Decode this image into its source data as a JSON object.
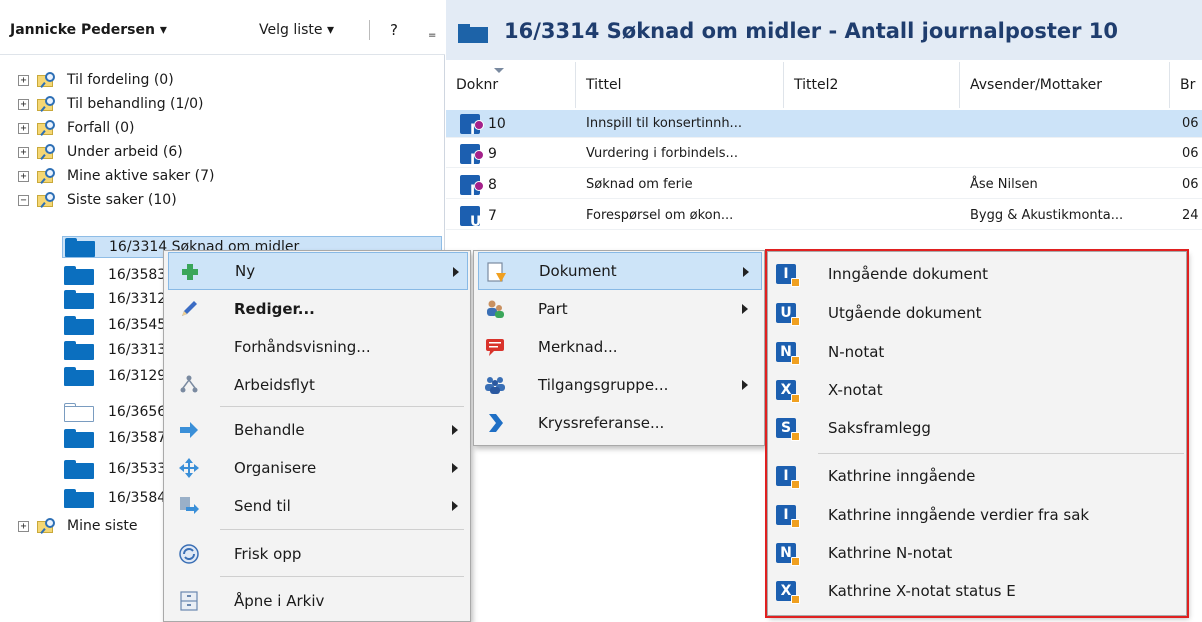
{
  "left_header": {
    "user": "Jannicke Pedersen",
    "user_arrow": "▾",
    "velg_liste": "Velg liste",
    "velg_arrow": "▾",
    "help": "?",
    "more": "="
  },
  "tree": [
    {
      "label": "Til fordeling (0)",
      "expander": "+"
    },
    {
      "label": "Til behandling (1/0)",
      "expander": "+"
    },
    {
      "label": "Forfall (0)",
      "expander": "+"
    },
    {
      "label": "Under arbeid (6)",
      "expander": "+"
    },
    {
      "label": "Mine aktive saker (7)",
      "expander": "+"
    },
    {
      "label": "Siste saker (10)",
      "expander": "−"
    }
  ],
  "cases": [
    {
      "label": "16/3314 Søknad om midler",
      "selected": true
    },
    {
      "label": "16/3583"
    },
    {
      "label": "16/3312"
    },
    {
      "label": "16/3545"
    },
    {
      "label": "16/3313"
    },
    {
      "label": "16/3129"
    },
    {
      "label": "16/3656",
      "empty": true
    },
    {
      "label": "16/3587"
    },
    {
      "label": "16/3533"
    },
    {
      "label": "16/3584"
    }
  ],
  "tree_last": {
    "label": "Mine siste",
    "expander": "+"
  },
  "right_header": {
    "title": "16/3314 Søknad om midler  - Antall journalposter 10"
  },
  "columns": [
    "Doknr",
    "Tittel",
    "Tittel2",
    "Avsender/Mottaker",
    "Br"
  ],
  "rows": [
    {
      "type": "I",
      "doknr": "10",
      "tittel": "Innspill til konsertinnh...",
      "avsender": "",
      "br": "06",
      "selected": true,
      "flag": true
    },
    {
      "type": "I",
      "doknr": "9",
      "tittel": "Vurdering i forbindels...",
      "avsender": "",
      "br": "06",
      "flag": true
    },
    {
      "type": "I",
      "doknr": "8",
      "tittel": "Søknad om ferie",
      "avsender": "Åse Nilsen",
      "br": "06",
      "flag": true
    },
    {
      "type": "U",
      "doknr": "7",
      "tittel": "Forespørsel om økon...",
      "avsender": "Bygg & Akustikmonta...",
      "br": "24",
      "flag": false
    }
  ],
  "menu1": [
    {
      "label": "Ny",
      "icon": "plus-icon",
      "submenu": true
    },
    {
      "label": "Rediger...",
      "icon": "pencil-icon",
      "bold": true
    },
    {
      "label": "Forhåndsvisning...",
      "icon": ""
    },
    {
      "label": "Arbeidsflyt",
      "icon": "workflow-icon"
    },
    {
      "label": "Behandle",
      "icon": "arrow-right-icon",
      "submenu": true
    },
    {
      "label": "Organisere",
      "icon": "move-icon",
      "submenu": true
    },
    {
      "label": "Send til",
      "icon": "send-to-icon",
      "submenu": true
    },
    {
      "label": "Frisk opp",
      "icon": "refresh-icon"
    },
    {
      "label": "Åpne i Arkiv",
      "icon": "archive-icon"
    }
  ],
  "menu2": [
    {
      "label": "Dokument",
      "icon": "document-icon",
      "submenu": true
    },
    {
      "label": "Part",
      "icon": "people-icon",
      "submenu": true
    },
    {
      "label": "Merknad...",
      "icon": "comment-icon"
    },
    {
      "label": "Tilgangsgruppe...",
      "icon": "group-icon",
      "submenu": true
    },
    {
      "label": "Kryssreferanse...",
      "icon": "chevron-right-icon"
    }
  ],
  "menu3": [
    {
      "label": "Inngående dokument",
      "letter": "I"
    },
    {
      "label": "Utgående dokument",
      "letter": "U"
    },
    {
      "label": "N-notat",
      "letter": "N"
    },
    {
      "label": "X-notat",
      "letter": "X"
    },
    {
      "label": "Saksframlegg",
      "letter": "S"
    },
    {
      "label": "Kathrine inngående",
      "letter": "I"
    },
    {
      "label": "Kathrine inngående verdier fra sak",
      "letter": "I"
    },
    {
      "label": "Kathrine N-notat",
      "letter": "N"
    },
    {
      "label": "Kathrine X-notat status E",
      "letter": "X"
    }
  ],
  "colors": {
    "accent": "#1c5fb0",
    "selection": "#cce3f8",
    "highlight_border": "#e02020",
    "header_bg": "#e3ebf5"
  }
}
